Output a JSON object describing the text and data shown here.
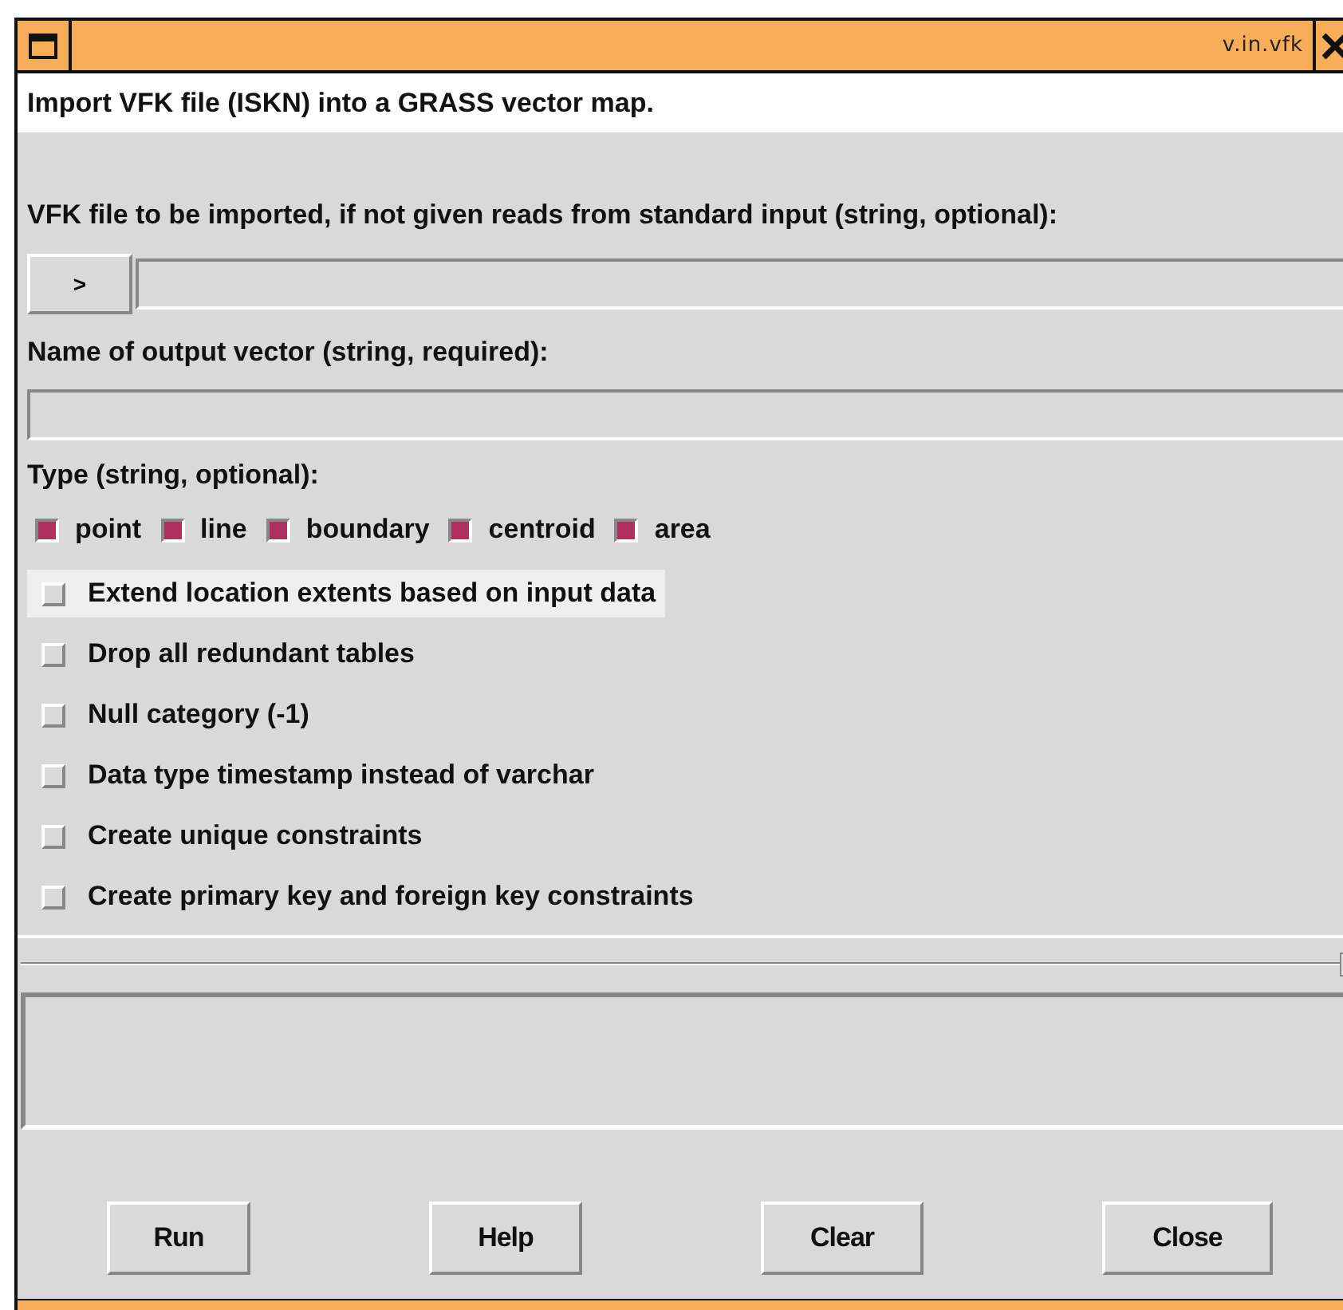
{
  "window": {
    "title": "v.in.vfk"
  },
  "description": "Import VFK file (ISKN) into a GRASS vector map.",
  "file_input": {
    "label": "VFK file to be imported, if not given reads from standard input (string, optional):",
    "browse_label": ">"
  },
  "output_input": {
    "label": "Name of output vector (string, required):"
  },
  "type_group": {
    "label": "Type (string, optional):",
    "options": [
      {
        "label": "point",
        "checked": true
      },
      {
        "label": "line",
        "checked": true
      },
      {
        "label": "boundary",
        "checked": true
      },
      {
        "label": "centroid",
        "checked": true
      },
      {
        "label": "area",
        "checked": true
      }
    ]
  },
  "flags": [
    {
      "label": "Extend location extents based on input data",
      "checked": false,
      "highlighted": true
    },
    {
      "label": "Drop all redundant tables",
      "checked": false,
      "highlighted": false
    },
    {
      "label": "Null category (-1)",
      "checked": false,
      "highlighted": false
    },
    {
      "label": "Data type timestamp instead of varchar",
      "checked": false,
      "highlighted": false
    },
    {
      "label": "Create unique constraints",
      "checked": false,
      "highlighted": false
    },
    {
      "label": "Create primary key and foreign key constraints",
      "checked": false,
      "highlighted": false
    }
  ],
  "buttons": [
    "Run",
    "Help",
    "Clear",
    "Close"
  ]
}
